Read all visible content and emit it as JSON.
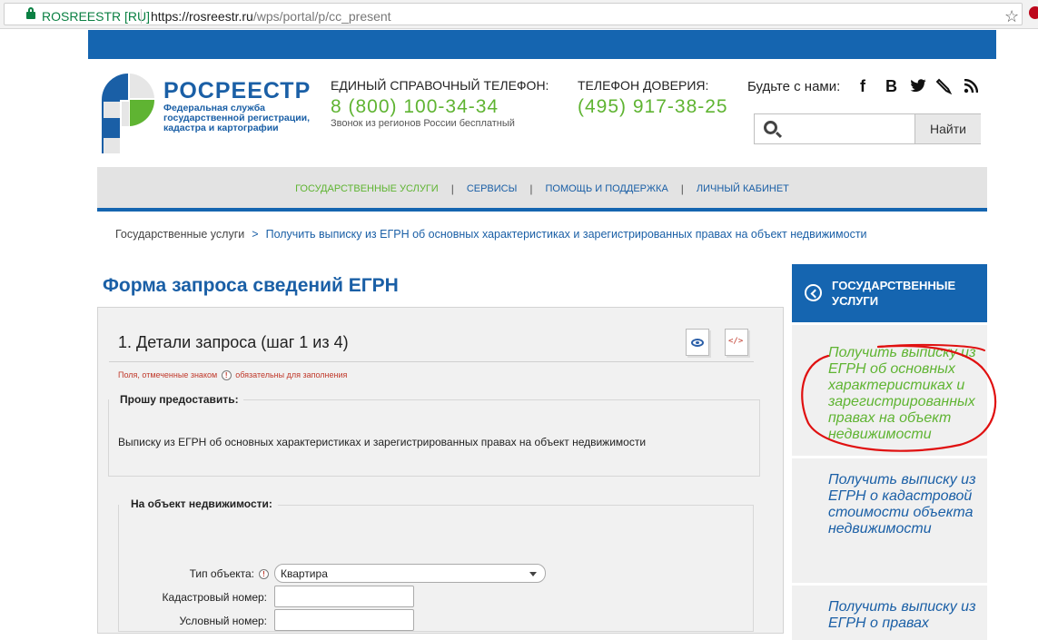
{
  "browser": {
    "site_identity": "ROSREESTR [RU]",
    "url_host": "https://rosreestr.ru",
    "url_path": "/wps/portal/p/cc_present",
    "star_icon": "star-icon"
  },
  "header": {
    "logo_title": "РОСРЕЕСТР",
    "logo_subtitle": "Федеральная служба государственной регистрации, кадастра и картографии",
    "phone1_label": "ЕДИНЫЙ СПРАВОЧНЫЙ ТЕЛЕФОН:",
    "phone1_number": "8 (800) 100-34-34",
    "phone1_note": "Звонок из регионов России бесплатный",
    "phone2_label": "ТЕЛЕФОН ДОВЕРИЯ:",
    "phone2_number": "(495) 917-38-25",
    "social_label": "Будьте с нами:",
    "social": [
      "f",
      "B",
      "🐦",
      "✎",
      "⌁"
    ],
    "search_placeholder": "",
    "search_button": "Найти",
    "colors": {
      "brand_blue": "#1565b0",
      "accent_green": "#5fb432"
    }
  },
  "nav": {
    "items": [
      {
        "label": "ГОСУДАРСТВЕННЫЕ УСЛУГИ",
        "active": true
      },
      {
        "label": "СЕРВИСЫ",
        "active": false
      },
      {
        "label": "ПОМОЩЬ И ПОДДЕРЖКА",
        "active": false
      },
      {
        "label": "ЛИЧНЫЙ КАБИНЕТ",
        "active": false
      }
    ],
    "separator": "|"
  },
  "breadcrumb": {
    "root": "Государственные услуги",
    "arrow": ">",
    "current": "Получить выписку из ЕГРН об основных характеристиках и зарегистрированных правах на объект недвижимости"
  },
  "page_title": "Форма запроса сведений ЕГРН",
  "form": {
    "step_title": "1. Детали запроса (шаг 1 из 4)",
    "preview_icon": "document-preview-icon",
    "xml_icon": "document-xml-icon",
    "xml_icon_text": "</>",
    "required_note_before": "Поля, отмеченные знаком",
    "required_note_after": "обязательны для заполнения",
    "required_mark": "!",
    "section1_legend": "Прошу предоставить:",
    "section1_text": "Выписку из ЕГРН об основных характеристиках и зарегистрированных правах на объект недвижимости",
    "section2_legend": "На объект недвижимости:",
    "object_type_label": "Тип объекта:",
    "object_type_value": "Квартира",
    "cadastral_label": "Кадастровый номер:",
    "cadastral_value": "",
    "conditional_label": "Условный номер:",
    "conditional_value": ""
  },
  "sidebar": {
    "header": "ГОСУДАРСТВЕННЫЕ УСЛУГИ",
    "items": [
      {
        "label": "Получить выписку из ЕГРН об основных характеристиках и зарегистрированных правах на объект недвижимости",
        "active": true
      },
      {
        "label": "Получить выписку из ЕГРН о кадастровой стоимости объекта недвижимости",
        "active": false
      },
      {
        "label": "Получить выписку из ЕГРН о правах",
        "active": false
      }
    ]
  }
}
